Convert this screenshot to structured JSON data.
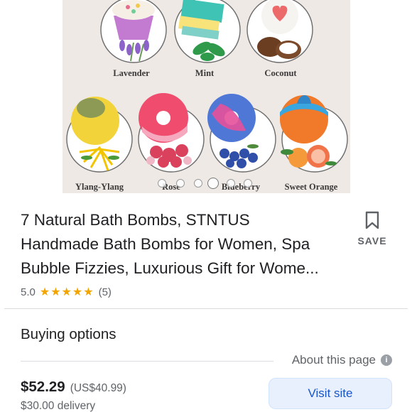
{
  "gallery": {
    "scents": [
      {
        "label": "Lavender"
      },
      {
        "label": "Mint"
      },
      {
        "label": "Coconut"
      },
      {
        "label": "Ylang-Ylang"
      },
      {
        "label": "Rose"
      },
      {
        "label": "Blueberry"
      },
      {
        "label": "Sweet Orange"
      }
    ],
    "dot_count": 6,
    "active_dot": 3
  },
  "product": {
    "title_line1": "7 Natural Bath Bombs, STNTUS",
    "title_line2": "Handmade Bath Bombs for Women, Spa",
    "title_line3": "Bubble Fizzies, Luxurious Gift for Wome...",
    "rating_value": "5.0",
    "stars": "★★★★★",
    "review_count": "(5)"
  },
  "save": {
    "label": "SAVE",
    "icon": "bookmark-icon"
  },
  "buying": {
    "section_title": "Buying options",
    "about_label": "About this page",
    "about_icon": "info-icon",
    "info_glyph": "i",
    "price": "$52.29",
    "price_alt": "(US$40.99)",
    "delivery": "$30.00 delivery",
    "visit_label": "Visit site"
  },
  "colors": {
    "star": "#f2a500",
    "visit_bg": "#e8f0fe",
    "visit_text": "#1a55c7",
    "hero_bg": "#efe9e6"
  }
}
